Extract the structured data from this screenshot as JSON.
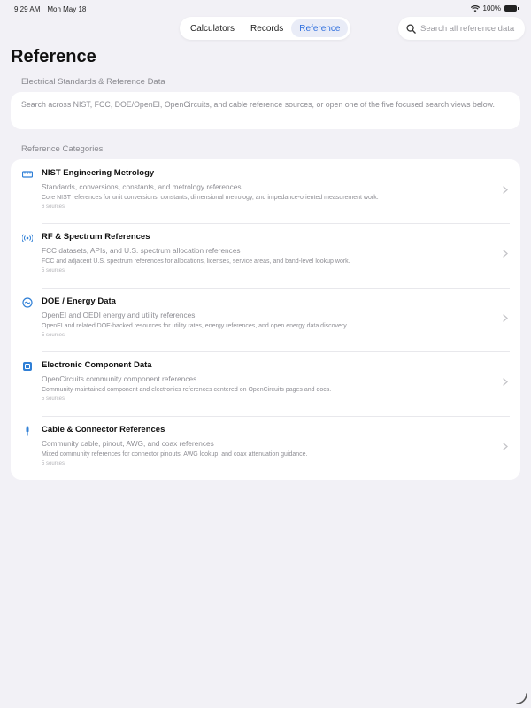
{
  "status": {
    "time": "9:29 AM",
    "date": "Mon May 18",
    "battery": "100%"
  },
  "nav": {
    "tabs": [
      {
        "label": "Calculators"
      },
      {
        "label": "Records"
      },
      {
        "label": "Reference",
        "active": true
      }
    ],
    "accent_color": "#2f6fde"
  },
  "search": {
    "placeholder": "Search all reference data",
    "value": ""
  },
  "page": {
    "title": "Reference",
    "section_standards": "Electrical Standards & Reference Data",
    "intro": "Search across NIST, FCC, DOE/OpenEI, OpenCircuits, and cable reference sources, or open one of the five focused search views below.",
    "section_categories": "Reference Categories"
  },
  "categories": [
    {
      "icon": "ruler-icon",
      "title": "NIST Engineering Metrology",
      "subtitle": "Standards, conversions, constants, and metrology references",
      "description": "Core NIST references for unit conversions, constants, dimensional metrology, and impedance-oriented measurement work.",
      "count": "6 sources"
    },
    {
      "icon": "antenna-icon",
      "title": "RF & Spectrum References",
      "subtitle": "FCC datasets, APIs, and U.S. spectrum allocation references",
      "description": "FCC and adjacent U.S. spectrum references for allocations, licenses, service areas, and band-level lookup work.",
      "count": "5 sources"
    },
    {
      "icon": "energy-icon",
      "title": "DOE / Energy Data",
      "subtitle": "OpenEI and OEDI energy and utility references",
      "description": "OpenEI and related DOE-backed resources for utility rates, energy references, and open energy data discovery.",
      "count": "5 sources"
    },
    {
      "icon": "chip-icon",
      "title": "Electronic Component Data",
      "subtitle": "OpenCircuits community component references",
      "description": "Community-maintained component and electronics references centered on OpenCircuits pages and docs.",
      "count": "5 sources"
    },
    {
      "icon": "cable-icon",
      "title": "Cable & Connector References",
      "subtitle": "Community cable, pinout, AWG, and coax references",
      "description": "Mixed community references for connector pinouts, AWG lookup, and coax attenuation guidance.",
      "count": "5 sources"
    }
  ]
}
